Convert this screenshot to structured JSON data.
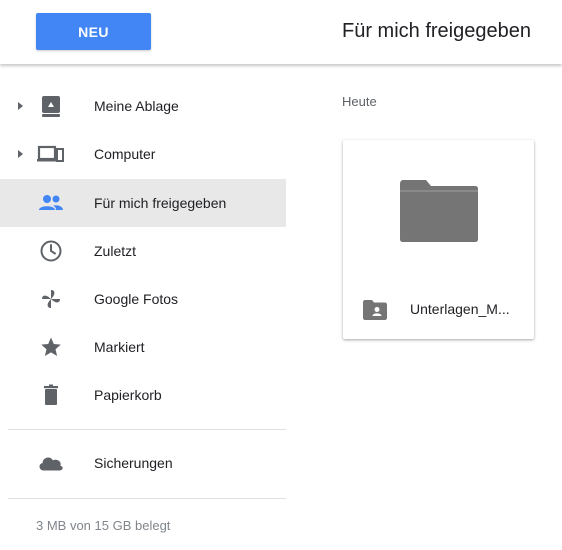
{
  "header": {
    "new_button_label": "NEU",
    "page_title": "Für mich freigegeben"
  },
  "sidebar": {
    "items": [
      {
        "label": "Meine Ablage",
        "icon": "my-drive-icon",
        "expandable": true
      },
      {
        "label": "Computer",
        "icon": "computer-icon",
        "expandable": true
      },
      {
        "label": "Für mich freigegeben",
        "icon": "shared-people-icon",
        "active": true
      },
      {
        "label": "Zuletzt",
        "icon": "clock-icon"
      },
      {
        "label": "Google Fotos",
        "icon": "pinwheel-icon"
      },
      {
        "label": "Markiert",
        "icon": "star-icon"
      },
      {
        "label": "Papierkorb",
        "icon": "trash-icon"
      },
      {
        "label": "Sicherungen",
        "icon": "cloud-icon"
      }
    ],
    "storage_text": "3 MB von 15 GB belegt"
  },
  "main": {
    "section_title": "Heute",
    "files": [
      {
        "name": "Unterlagen_M...",
        "type": "shared-folder"
      }
    ]
  },
  "colors": {
    "accent": "#4285f4",
    "active_bg": "#e8e8e8",
    "icon_gray": "#5f6368",
    "folder_gray": "#757575"
  }
}
